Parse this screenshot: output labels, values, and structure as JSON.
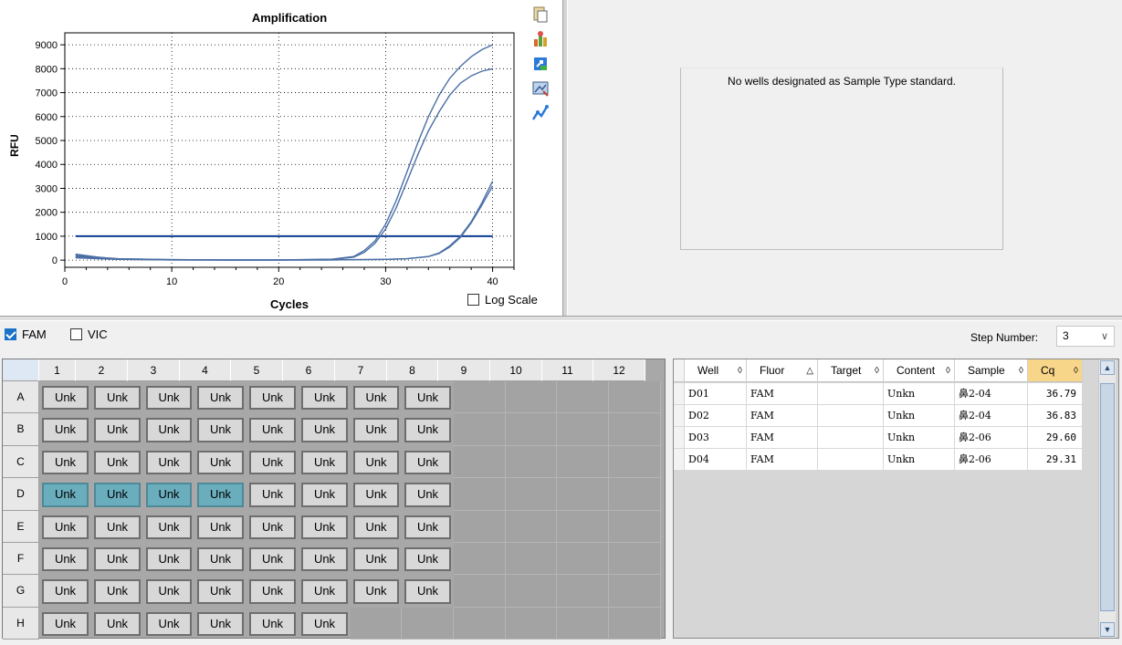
{
  "chart": {
    "title": "Amplification",
    "xlabel": "Cycles",
    "ylabel": "RFU",
    "log_scale_label": "Log Scale",
    "log_scale_checked": false
  },
  "chart_data": {
    "type": "line",
    "title": "Amplification",
    "xlabel": "Cycles",
    "ylabel": "RFU",
    "xlim": [
      0,
      42
    ],
    "ylim": [
      -300,
      9500
    ],
    "x_ticks": [
      0,
      10,
      20,
      30,
      40
    ],
    "y_ticks": [
      0,
      1000,
      2000,
      3000,
      4000,
      5000,
      6000,
      7000,
      8000,
      9000
    ],
    "grid": "dotted",
    "threshold": 1000,
    "series": [
      {
        "x": [
          1,
          3,
          5,
          10,
          15,
          20,
          25,
          27,
          28,
          29,
          30,
          31,
          32,
          33,
          34,
          35,
          36,
          37,
          38,
          39,
          40
        ],
        "y": [
          200,
          120,
          60,
          20,
          10,
          10,
          40,
          150,
          400,
          800,
          1500,
          2500,
          3700,
          4900,
          6000,
          6900,
          7600,
          8100,
          8500,
          8800,
          9000
        ]
      },
      {
        "x": [
          1,
          3,
          5,
          10,
          15,
          20,
          25,
          27,
          28,
          29,
          30,
          31,
          32,
          33,
          34,
          35,
          36,
          37,
          38,
          39,
          40
        ],
        "y": [
          150,
          100,
          50,
          20,
          10,
          10,
          30,
          120,
          320,
          700,
          1300,
          2200,
          3300,
          4400,
          5400,
          6200,
          6900,
          7400,
          7700,
          7900,
          8000
        ]
      },
      {
        "x": [
          1,
          3,
          5,
          10,
          15,
          20,
          25,
          30,
          32,
          34,
          35,
          36,
          37,
          38,
          39,
          40
        ],
        "y": [
          100,
          60,
          30,
          10,
          5,
          5,
          10,
          30,
          60,
          150,
          300,
          600,
          1000,
          1600,
          2400,
          3300
        ]
      },
      {
        "x": [
          1,
          3,
          5,
          10,
          15,
          20,
          25,
          30,
          32,
          34,
          35,
          36,
          37,
          38,
          39,
          40
        ],
        "y": [
          250,
          130,
          40,
          10,
          5,
          5,
          10,
          30,
          60,
          150,
          280,
          550,
          950,
          1550,
          2300,
          3100
        ]
      }
    ]
  },
  "standard_curve": {
    "message": "No wells designated as Sample Type standard."
  },
  "fluors": [
    {
      "label": "FAM",
      "checked": true
    },
    {
      "label": "VIC",
      "checked": false
    }
  ],
  "step": {
    "label": "Step Number:",
    "value": "3"
  },
  "plate": {
    "columns": [
      "1",
      "2",
      "3",
      "4",
      "5",
      "6",
      "7",
      "8",
      "9",
      "10",
      "11",
      "12"
    ],
    "rows": [
      "A",
      "B",
      "C",
      "D",
      "E",
      "F",
      "G",
      "H"
    ],
    "well_label": "Unk",
    "filled_columns_per_row": [
      8,
      8,
      8,
      8,
      8,
      8,
      8,
      6
    ],
    "selected_row": "D",
    "selected_columns": [
      1,
      2,
      3,
      4
    ]
  },
  "results_table": {
    "headers": [
      {
        "label": "Well",
        "icon": "◊"
      },
      {
        "label": "Fluor",
        "icon": "△"
      },
      {
        "label": "Target",
        "icon": "◊"
      },
      {
        "label": "Content",
        "icon": "◊"
      },
      {
        "label": "Sample",
        "icon": "◊"
      },
      {
        "label": "Cq",
        "icon": "◊"
      }
    ],
    "rows": [
      {
        "well": "D01",
        "fluor": "FAM",
        "target": "",
        "content": "Unkn",
        "sample": "鼻2-04",
        "cq": "36.79"
      },
      {
        "well": "D02",
        "fluor": "FAM",
        "target": "",
        "content": "Unkn",
        "sample": "鼻2-04",
        "cq": "36.83"
      },
      {
        "well": "D03",
        "fluor": "FAM",
        "target": "",
        "content": "Unkn",
        "sample": "鼻2-06",
        "cq": "29.60"
      },
      {
        "well": "D04",
        "fluor": "FAM",
        "target": "",
        "content": "Unkn",
        "sample": "鼻2-06",
        "cq": "29.31"
      }
    ]
  },
  "toolbar_icons": [
    "copy-icon",
    "chart-settings-icon",
    "export-icon",
    "image-icon",
    "line-style-icon"
  ],
  "colors": {
    "curve": "#4a6fa5",
    "threshold": "#0b3d91",
    "selected_well": "#6aaebe"
  }
}
